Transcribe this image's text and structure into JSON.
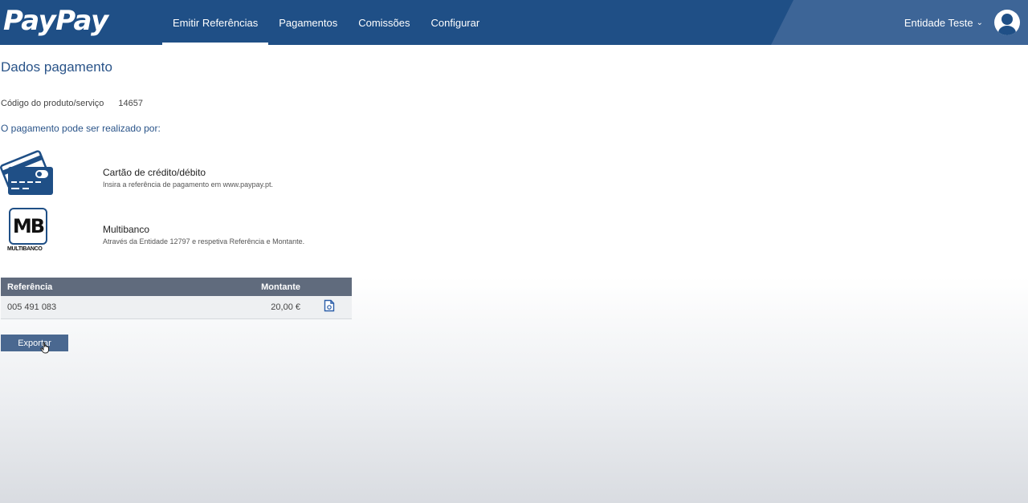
{
  "brand": {
    "logo_text": "PayPay",
    "primary_color": "#1f4f86"
  },
  "nav": {
    "items": [
      {
        "label": "Emitir Referências",
        "active": true
      },
      {
        "label": "Pagamentos",
        "active": false
      },
      {
        "label": "Comissões",
        "active": false
      },
      {
        "label": "Configurar",
        "active": false
      }
    ]
  },
  "user": {
    "name": "Entidade Teste",
    "menu_icon": "chevron-down-icon",
    "avatar_icon": "user-avatar-icon"
  },
  "page": {
    "title": "Dados pagamento",
    "product_code_label": "Código do produto/serviço",
    "product_code_value": "14657",
    "payment_intro": "O pagamento pode ser realizado por:"
  },
  "methods": [
    {
      "name": "Cartão de crédito/débito",
      "description": "Insira a referência de pagamento em www.paypay.pt.",
      "icon": "credit-card-icon"
    },
    {
      "name": "Multibanco",
      "description": "Através da Entidade 12797 e respetiva Referência e Montante.",
      "icon": "multibanco-icon",
      "logo_text": "MB",
      "logo_subtext": "MULTIBANCO"
    }
  ],
  "table": {
    "headers": {
      "reference": "Referência",
      "amount": "Montante"
    },
    "rows": [
      {
        "reference": "005 491 083",
        "amount": "20,00 €"
      }
    ]
  },
  "actions": {
    "export_label": "Exportar"
  }
}
